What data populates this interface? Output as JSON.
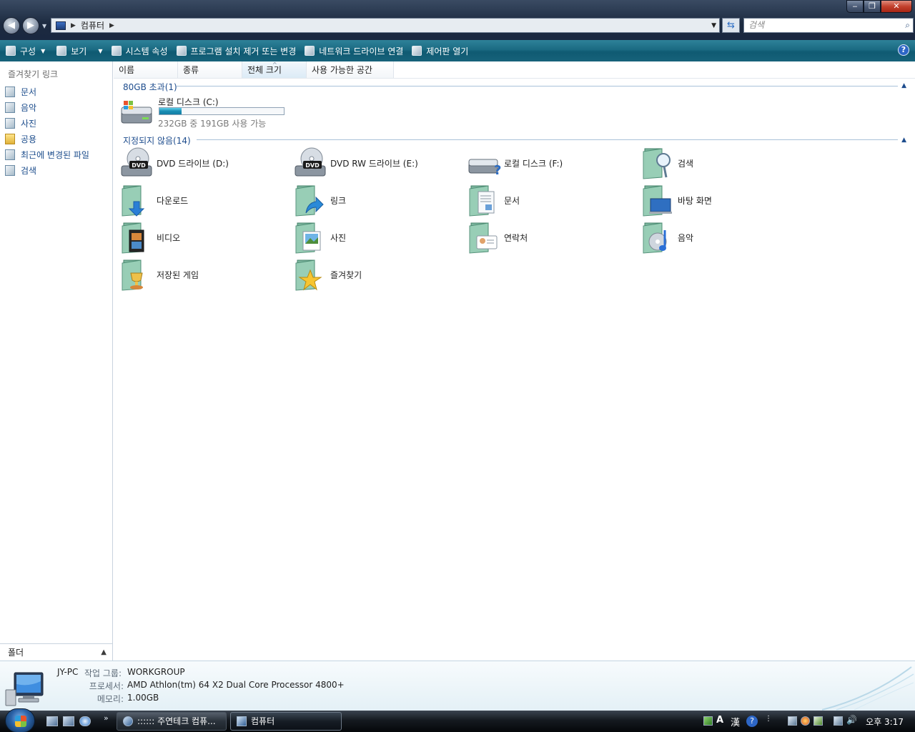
{
  "window": {
    "controls": {
      "minimize": "‒",
      "maximize": "❐",
      "close": "✕"
    },
    "nav": {
      "back": "◀",
      "forward": "▶"
    },
    "address": {
      "crumbs": [
        "컴퓨터"
      ]
    },
    "search": {
      "placeholder": "검색"
    }
  },
  "commandbar": {
    "items": [
      {
        "label": "구성",
        "has_menu": true
      },
      {
        "label": "보기",
        "has_menu": true
      },
      {
        "label": "시스템 속성"
      },
      {
        "label": "프로그램 설치 제거 또는 변경"
      },
      {
        "label": "네트워크 드라이브 연결"
      },
      {
        "label": "제어판 열기"
      }
    ],
    "help": "?"
  },
  "sidebar": {
    "title": "즐겨찾기 링크",
    "items": [
      {
        "label": "문서",
        "icon": "documents-icon"
      },
      {
        "label": "음악",
        "icon": "music-icon"
      },
      {
        "label": "사진",
        "icon": "pictures-icon"
      },
      {
        "label": "공용",
        "icon": "public-folder-icon"
      },
      {
        "label": "최근에 변경된 파일",
        "icon": "recent-files-icon"
      },
      {
        "label": "검색",
        "icon": "search-folder-icon"
      }
    ],
    "folders_label": "폴더"
  },
  "columns": [
    "이름",
    "종류",
    "전체 크기",
    "사용 가능한 공간"
  ],
  "groups": {
    "large": {
      "title": "80GB 초과(1)",
      "drive": {
        "name": "로컬 디스크 (C:)",
        "used_fraction": 0.177,
        "free_text": "232GB 중 191GB 사용 가능"
      }
    },
    "unspecified": {
      "title": "지정되지 않음(14)",
      "items": [
        {
          "label": "DVD 드라이브 (D:)",
          "icon": "dvd-drive-icon"
        },
        {
          "label": "DVD RW 드라이브 (E:)",
          "icon": "dvd-rw-drive-icon"
        },
        {
          "label": "로컬 디스크 (F:)",
          "icon": "unknown-disk-icon"
        },
        {
          "label": "검색",
          "icon": "search-folder-icon"
        },
        {
          "label": "다운로드",
          "icon": "downloads-folder-icon"
        },
        {
          "label": "링크",
          "icon": "links-folder-icon"
        },
        {
          "label": "문서",
          "icon": "documents-folder-icon"
        },
        {
          "label": "바탕 화면",
          "icon": "desktop-folder-icon"
        },
        {
          "label": "비디오",
          "icon": "videos-folder-icon"
        },
        {
          "label": "사진",
          "icon": "pictures-folder-icon"
        },
        {
          "label": "연락처",
          "icon": "contacts-folder-icon"
        },
        {
          "label": "음악",
          "icon": "music-folder-icon"
        },
        {
          "label": "저장된 게임",
          "icon": "saved-games-folder-icon"
        },
        {
          "label": "즐겨찾기",
          "icon": "favorites-folder-icon"
        }
      ]
    }
  },
  "details": {
    "computer_name": "JY-PC",
    "workgroup_label": "작업 그룹:",
    "workgroup": "WORKGROUP",
    "processor_label": "프로세서:",
    "processor": "AMD Athlon(tm) 64 X2 Dual Core Processor 4800+",
    "memory_label": "메모리:",
    "memory": "1.00GB"
  },
  "taskbar": {
    "quicklaunch_more": "»",
    "tasks": [
      {
        "label": ":::::: 주연테크 컴퓨...",
        "active": false
      },
      {
        "label": "컴퓨터",
        "active": true
      }
    ],
    "tray": {
      "ime_mode": "A",
      "hanja": "漢",
      "help": "?"
    },
    "clock": "오후 3:17"
  },
  "colors": {
    "accent": "#1d4c8d",
    "commandbar": "#1b6a82",
    "progress": "#1a8db3"
  }
}
